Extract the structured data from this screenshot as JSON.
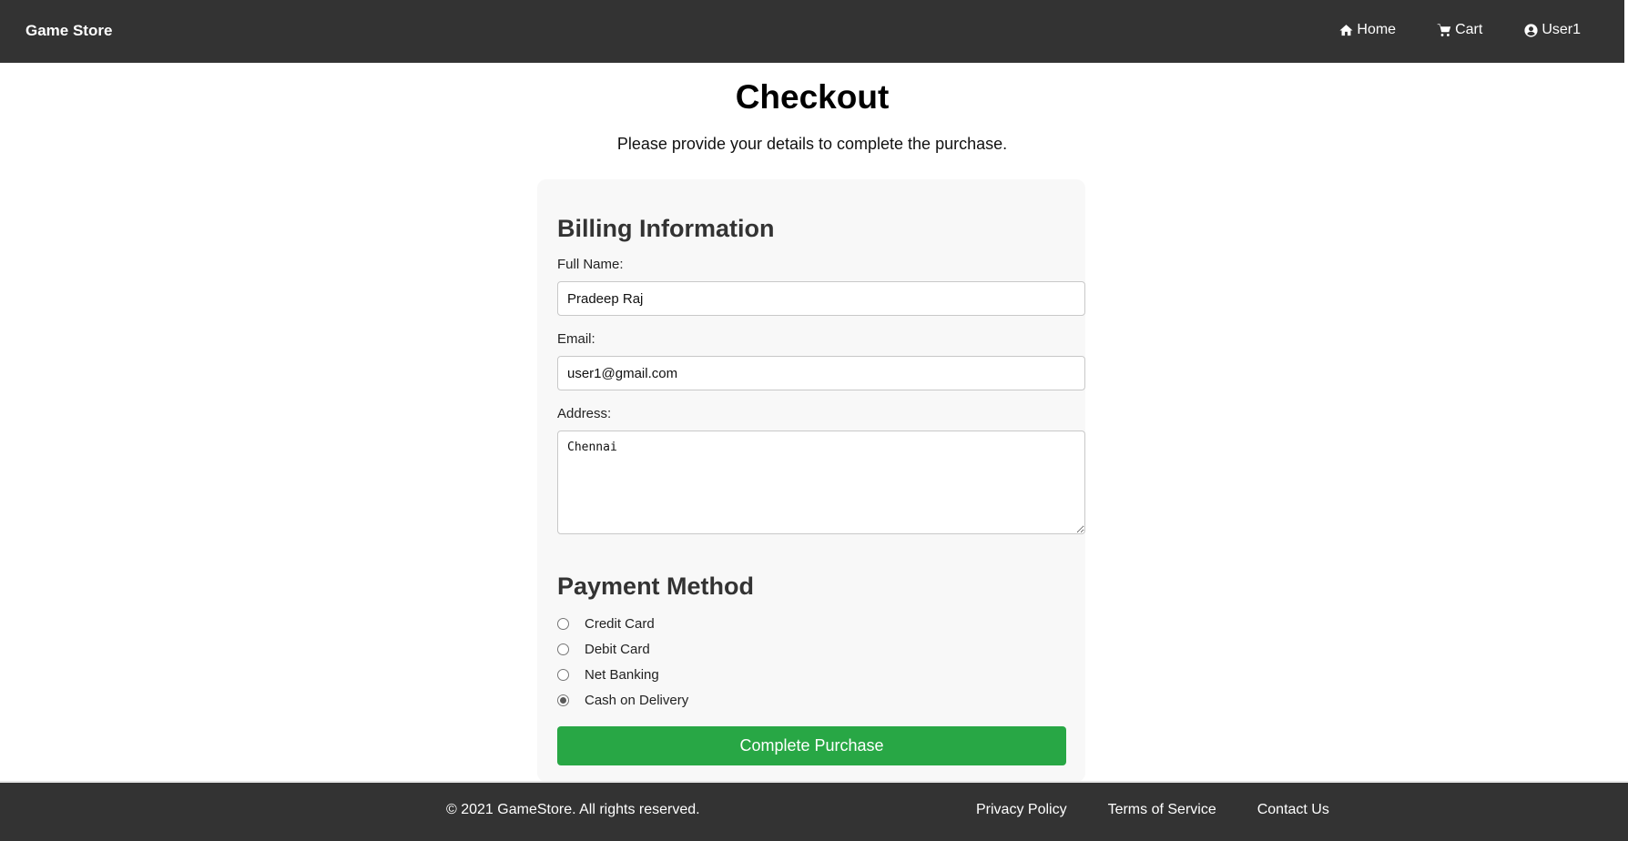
{
  "nav": {
    "brand": "Game Store",
    "links": [
      {
        "label": "Home",
        "icon": "home-icon"
      },
      {
        "label": "Cart",
        "icon": "cart-icon"
      },
      {
        "label": "User1",
        "icon": "user-circle-icon"
      }
    ]
  },
  "header": {
    "title": "Checkout",
    "subtitle": "Please provide your details to complete the purchase."
  },
  "billing": {
    "title": "Billing Information",
    "full_name_label": "Full Name:",
    "full_name_value": "Pradeep Raj",
    "email_label": "Email:",
    "email_value": "user1@gmail.com",
    "address_label": "Address:",
    "address_value": "Chennai"
  },
  "payment": {
    "title": "Payment Method",
    "options": [
      {
        "label": "Credit Card",
        "selected": false
      },
      {
        "label": "Debit Card",
        "selected": false
      },
      {
        "label": "Net Banking",
        "selected": false
      },
      {
        "label": "Cash on Delivery",
        "selected": true
      }
    ],
    "submit_label": "Complete Purchase"
  },
  "footer": {
    "copyright": "© 2021 GameStore. All rights reserved.",
    "links": [
      "Privacy Policy",
      "Terms of Service",
      "Contact Us"
    ]
  },
  "colors": {
    "nav_bg": "#333333",
    "accent": "#28a745",
    "card_bg": "#f8f8f8"
  }
}
